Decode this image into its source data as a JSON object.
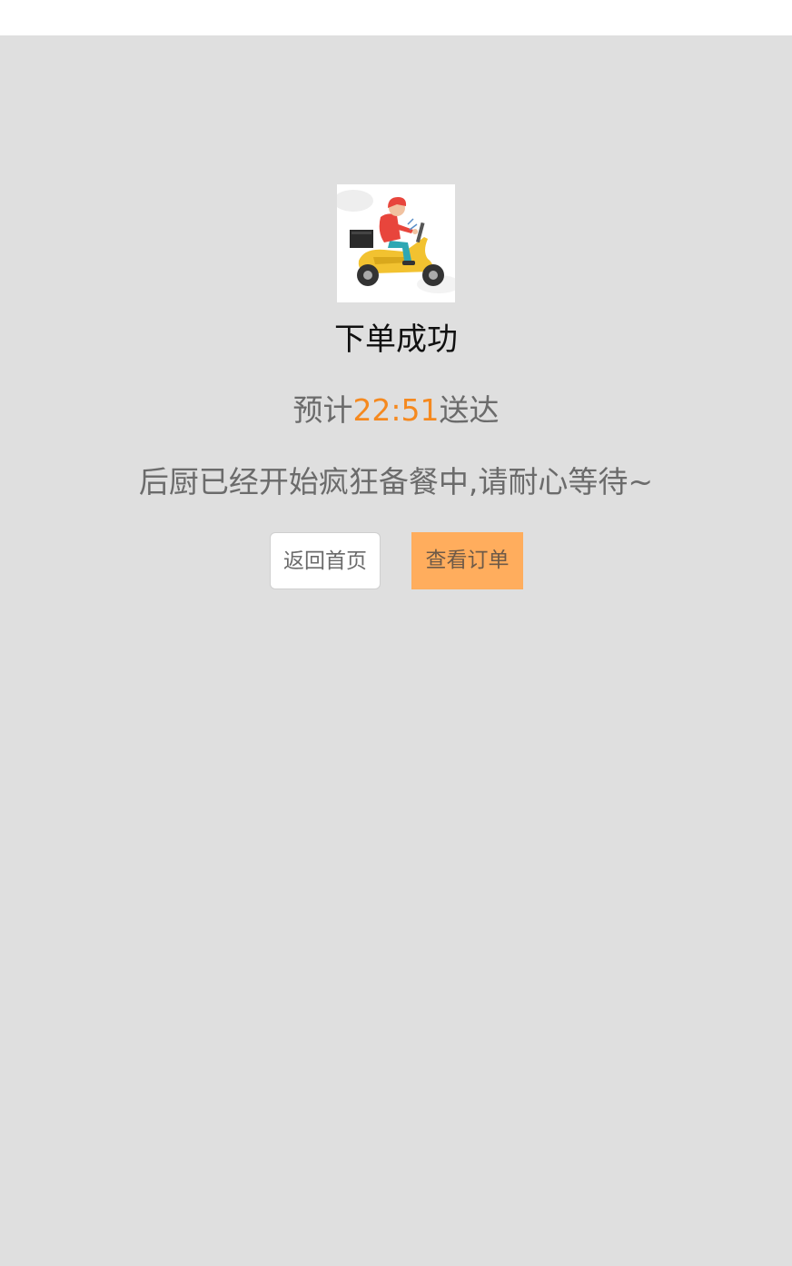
{
  "page": {
    "title": "下单成功",
    "eta_prefix": "预计",
    "eta_time": "22:51",
    "eta_suffix": "送达",
    "message": "后厨已经开始疯狂备餐中,请耐心等待~"
  },
  "actions": {
    "home_label": "返回首页",
    "order_label": "查看订单"
  },
  "illustration": {
    "icon": "delivery-scooter-icon"
  },
  "colors": {
    "background": "#dfdfdf",
    "accent_time": "#f5891f",
    "primary_button": "#ffad5d",
    "secondary_button": "#ffffff"
  }
}
